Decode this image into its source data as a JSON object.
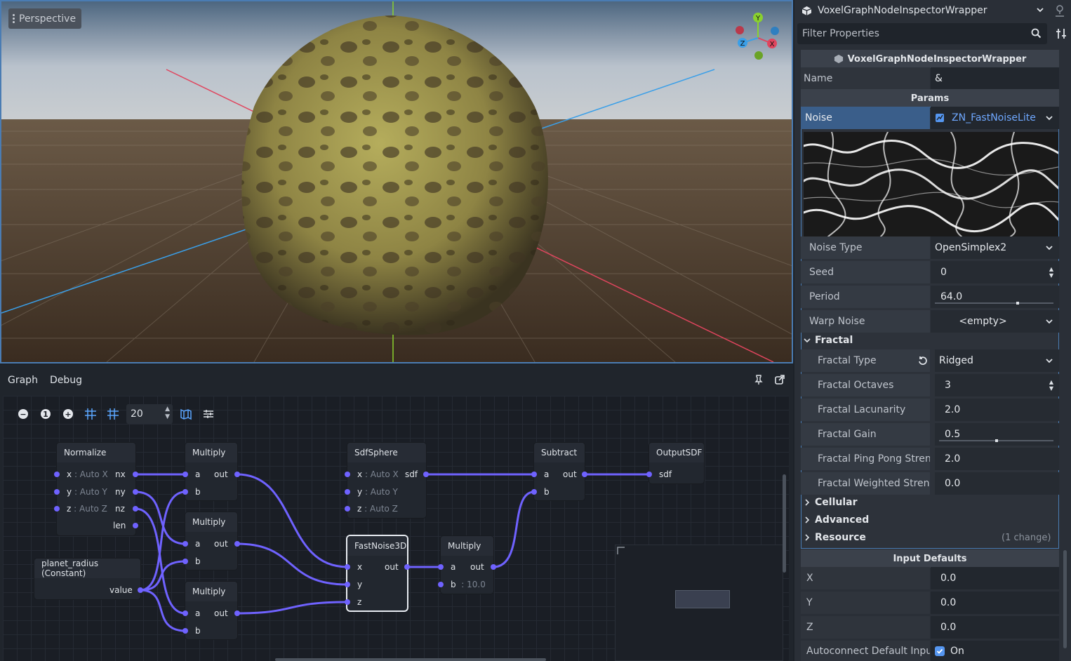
{
  "viewport": {
    "view_mode_label": "Perspective",
    "gizmo": {
      "y_label": "Y",
      "x_label": "X",
      "z_label": "Z"
    }
  },
  "graph_panel": {
    "tabs": [
      "Graph",
      "Debug"
    ],
    "zoom_value": "20",
    "nodes": {
      "normalize": {
        "title": "Normalize",
        "x": "x",
        "x_hint": ": Auto X",
        "x_out": "nx",
        "y": "y",
        "y_hint": ": Auto Y",
        "y_out": "ny",
        "z": "z",
        "z_hint": ": Auto Z",
        "z_out": "nz",
        "len": "len"
      },
      "multiply1": {
        "title": "Multiply",
        "a": "a",
        "b": "b",
        "out": "out"
      },
      "multiply2": {
        "title": "Multiply",
        "a": "a",
        "b": "b",
        "out": "out"
      },
      "multiply3": {
        "title": "Multiply",
        "a": "a",
        "b": "b",
        "out": "out"
      },
      "planet_radius": {
        "title": "planet_radius (Constant)",
        "value": "value"
      },
      "sdfsphere": {
        "title": "SdfSphere",
        "x": "x",
        "x_hint": ": Auto X",
        "out": "sdf",
        "y": "y",
        "y_hint": ": Auto Y",
        "z": "z",
        "z_hint": ": Auto Z"
      },
      "fastnoise": {
        "title": "FastNoise3D",
        "x": "x",
        "y": "y",
        "z": "z",
        "out": "out"
      },
      "multiply4": {
        "title": "Multiply",
        "a": "a",
        "b": "b",
        "b_hint": ": 10.0",
        "out": "out"
      },
      "subtract": {
        "title": "Subtract",
        "a": "a",
        "b": "b",
        "out": "out"
      },
      "output": {
        "title": "OutputSDF",
        "sdf": "sdf"
      }
    }
  },
  "inspector": {
    "object_name": "VoxelGraphNodeInspectorWrapper",
    "filter_placeholder": "Filter Properties",
    "resource_title": "VoxelGraphNodeInspectorWrapper",
    "name_label": "Name",
    "name_value": "&",
    "params_title": "Params",
    "noise_label": "Noise",
    "noise_value": "ZN_FastNoiseLite",
    "rows": {
      "noise_type": {
        "label": "Noise Type",
        "value": "OpenSimplex2"
      },
      "seed": {
        "label": "Seed",
        "value": "0"
      },
      "period": {
        "label": "Period",
        "value": "64.0",
        "slider_fraction": 0.7
      },
      "warp_noise": {
        "label": "Warp Noise",
        "value": "<empty>"
      }
    },
    "fractal_group": "Fractal",
    "fractal_rows": {
      "type": {
        "label": "Fractal Type",
        "value": "Ridged"
      },
      "octaves": {
        "label": "Fractal Octaves",
        "value": "3"
      },
      "lacunarity": {
        "label": "Fractal Lacunarity",
        "value": "2.0"
      },
      "gain": {
        "label": "Fractal Gain",
        "value": "0.5",
        "slider_fraction": 0.5
      },
      "ping_pong": {
        "label": "Fractal Ping Pong Streng",
        "value": "2.0"
      },
      "weighted": {
        "label": "Fractal Weighted Strengt",
        "value": "0.0"
      }
    },
    "groups": {
      "cellular": "Cellular",
      "advanced": "Advanced",
      "resource": "Resource",
      "resource_note": "(1 change)"
    },
    "input_defaults_title": "Input Defaults",
    "inputs": {
      "x": {
        "label": "X",
        "value": "0.0"
      },
      "y": {
        "label": "Y",
        "value": "0.0"
      },
      "z": {
        "label": "Z",
        "value": "0.0"
      }
    },
    "autoconnect": {
      "label": "Autoconnect Default Inpu",
      "value": "On"
    }
  },
  "colors": {
    "accent": "#4a7cb3",
    "wire": "#6f62ff",
    "axis_x": "#e0455e",
    "axis_z": "#3a9fe8",
    "axis_y": "#8ad12e",
    "planet": "#a8a24d"
  }
}
